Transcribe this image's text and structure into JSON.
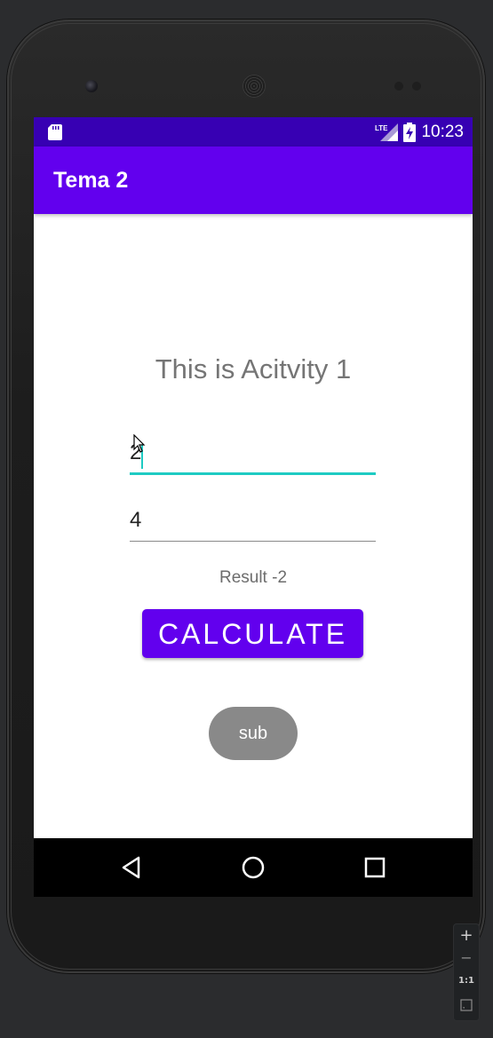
{
  "status_bar": {
    "time": "10:23",
    "network_label": "LTE",
    "icons": [
      "sd-card-icon",
      "signal-icon",
      "battery-charging-icon"
    ]
  },
  "app_bar": {
    "title": "Tema 2"
  },
  "main": {
    "heading": "This is Acitvity 1",
    "input_1": {
      "value": "2"
    },
    "input_2": {
      "value": "4"
    },
    "result_text": "Result -2",
    "calculate_label": "CALCULATE",
    "sub_label": "sub"
  },
  "nav_bar": {
    "buttons": [
      "back-icon",
      "home-icon",
      "recents-icon"
    ]
  },
  "emulator_zoom": {
    "zoom_in": "+",
    "zoom_out": "−",
    "actual_size": "1:1"
  },
  "colors": {
    "status_bar": "#3700b3",
    "primary": "#6200ee",
    "accent_underline": "#1ecbc3",
    "sub_button": "#898989"
  }
}
